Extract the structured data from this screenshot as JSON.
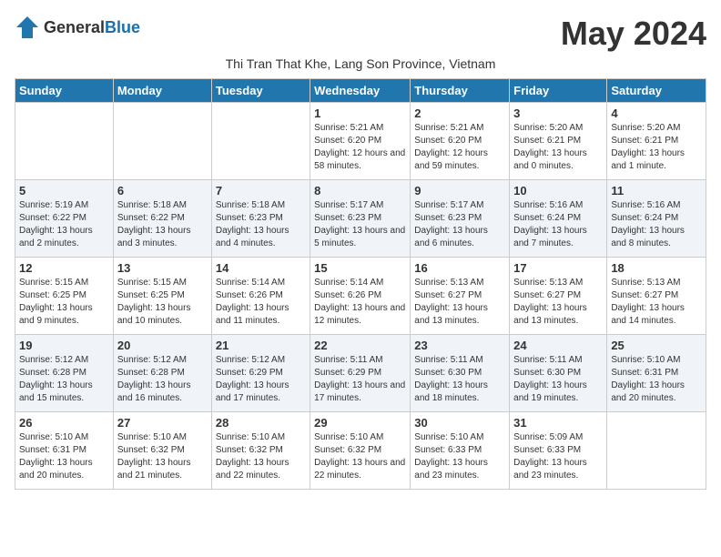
{
  "logo": {
    "general": "General",
    "blue": "Blue"
  },
  "title": "May 2024",
  "subtitle": "Thi Tran That Khe, Lang Son Province, Vietnam",
  "weekdays": [
    "Sunday",
    "Monday",
    "Tuesday",
    "Wednesday",
    "Thursday",
    "Friday",
    "Saturday"
  ],
  "weeks": [
    [
      {
        "day": "",
        "info": ""
      },
      {
        "day": "",
        "info": ""
      },
      {
        "day": "",
        "info": ""
      },
      {
        "day": "1",
        "info": "Sunrise: 5:21 AM\nSunset: 6:20 PM\nDaylight: 12 hours and 58 minutes."
      },
      {
        "day": "2",
        "info": "Sunrise: 5:21 AM\nSunset: 6:20 PM\nDaylight: 12 hours and 59 minutes."
      },
      {
        "day": "3",
        "info": "Sunrise: 5:20 AM\nSunset: 6:21 PM\nDaylight: 13 hours and 0 minutes."
      },
      {
        "day": "4",
        "info": "Sunrise: 5:20 AM\nSunset: 6:21 PM\nDaylight: 13 hours and 1 minute."
      }
    ],
    [
      {
        "day": "5",
        "info": "Sunrise: 5:19 AM\nSunset: 6:22 PM\nDaylight: 13 hours and 2 minutes."
      },
      {
        "day": "6",
        "info": "Sunrise: 5:18 AM\nSunset: 6:22 PM\nDaylight: 13 hours and 3 minutes."
      },
      {
        "day": "7",
        "info": "Sunrise: 5:18 AM\nSunset: 6:23 PM\nDaylight: 13 hours and 4 minutes."
      },
      {
        "day": "8",
        "info": "Sunrise: 5:17 AM\nSunset: 6:23 PM\nDaylight: 13 hours and 5 minutes."
      },
      {
        "day": "9",
        "info": "Sunrise: 5:17 AM\nSunset: 6:23 PM\nDaylight: 13 hours and 6 minutes."
      },
      {
        "day": "10",
        "info": "Sunrise: 5:16 AM\nSunset: 6:24 PM\nDaylight: 13 hours and 7 minutes."
      },
      {
        "day": "11",
        "info": "Sunrise: 5:16 AM\nSunset: 6:24 PM\nDaylight: 13 hours and 8 minutes."
      }
    ],
    [
      {
        "day": "12",
        "info": "Sunrise: 5:15 AM\nSunset: 6:25 PM\nDaylight: 13 hours and 9 minutes."
      },
      {
        "day": "13",
        "info": "Sunrise: 5:15 AM\nSunset: 6:25 PM\nDaylight: 13 hours and 10 minutes."
      },
      {
        "day": "14",
        "info": "Sunrise: 5:14 AM\nSunset: 6:26 PM\nDaylight: 13 hours and 11 minutes."
      },
      {
        "day": "15",
        "info": "Sunrise: 5:14 AM\nSunset: 6:26 PM\nDaylight: 13 hours and 12 minutes."
      },
      {
        "day": "16",
        "info": "Sunrise: 5:13 AM\nSunset: 6:27 PM\nDaylight: 13 hours and 13 minutes."
      },
      {
        "day": "17",
        "info": "Sunrise: 5:13 AM\nSunset: 6:27 PM\nDaylight: 13 hours and 13 minutes."
      },
      {
        "day": "18",
        "info": "Sunrise: 5:13 AM\nSunset: 6:27 PM\nDaylight: 13 hours and 14 minutes."
      }
    ],
    [
      {
        "day": "19",
        "info": "Sunrise: 5:12 AM\nSunset: 6:28 PM\nDaylight: 13 hours and 15 minutes."
      },
      {
        "day": "20",
        "info": "Sunrise: 5:12 AM\nSunset: 6:28 PM\nDaylight: 13 hours and 16 minutes."
      },
      {
        "day": "21",
        "info": "Sunrise: 5:12 AM\nSunset: 6:29 PM\nDaylight: 13 hours and 17 minutes."
      },
      {
        "day": "22",
        "info": "Sunrise: 5:11 AM\nSunset: 6:29 PM\nDaylight: 13 hours and 17 minutes."
      },
      {
        "day": "23",
        "info": "Sunrise: 5:11 AM\nSunset: 6:30 PM\nDaylight: 13 hours and 18 minutes."
      },
      {
        "day": "24",
        "info": "Sunrise: 5:11 AM\nSunset: 6:30 PM\nDaylight: 13 hours and 19 minutes."
      },
      {
        "day": "25",
        "info": "Sunrise: 5:10 AM\nSunset: 6:31 PM\nDaylight: 13 hours and 20 minutes."
      }
    ],
    [
      {
        "day": "26",
        "info": "Sunrise: 5:10 AM\nSunset: 6:31 PM\nDaylight: 13 hours and 20 minutes."
      },
      {
        "day": "27",
        "info": "Sunrise: 5:10 AM\nSunset: 6:32 PM\nDaylight: 13 hours and 21 minutes."
      },
      {
        "day": "28",
        "info": "Sunrise: 5:10 AM\nSunset: 6:32 PM\nDaylight: 13 hours and 22 minutes."
      },
      {
        "day": "29",
        "info": "Sunrise: 5:10 AM\nSunset: 6:32 PM\nDaylight: 13 hours and 22 minutes."
      },
      {
        "day": "30",
        "info": "Sunrise: 5:10 AM\nSunset: 6:33 PM\nDaylight: 13 hours and 23 minutes."
      },
      {
        "day": "31",
        "info": "Sunrise: 5:09 AM\nSunset: 6:33 PM\nDaylight: 13 hours and 23 minutes."
      },
      {
        "day": "",
        "info": ""
      }
    ]
  ]
}
